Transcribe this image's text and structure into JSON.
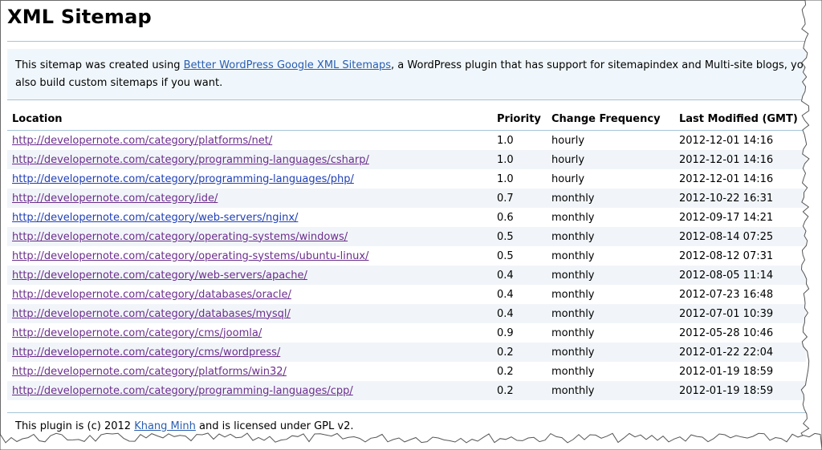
{
  "page": {
    "title": "XML Sitemap",
    "intro": {
      "text_before": "This sitemap was created using ",
      "plugin_link": "Better WordPress Google XML Sitemaps",
      "text_after": ", a WordPress plugin that has support for sitemapindex and Multi-site blogs, you can",
      "line2": "also build custom sitemaps if you want."
    },
    "table": {
      "headers": {
        "location": "Location",
        "priority": "Priority",
        "frequency": "Change Frequency",
        "modified": "Last Modified (GMT)"
      },
      "rows": [
        {
          "url": "http://developernote.com/category/platforms/net/",
          "priority": "1.0",
          "frequency": "hourly",
          "modified": "2012-12-01 14:16",
          "visited": true
        },
        {
          "url": "http://developernote.com/category/programming-languages/csharp/",
          "priority": "1.0",
          "frequency": "hourly",
          "modified": "2012-12-01 14:16",
          "visited": true
        },
        {
          "url": "http://developernote.com/category/programming-languages/php/",
          "priority": "1.0",
          "frequency": "hourly",
          "modified": "2012-12-01 14:16",
          "visited": false
        },
        {
          "url": "http://developernote.com/category/ide/",
          "priority": "0.7",
          "frequency": "monthly",
          "modified": "2012-10-22 16:31",
          "visited": true
        },
        {
          "url": "http://developernote.com/category/web-servers/nginx/",
          "priority": "0.6",
          "frequency": "monthly",
          "modified": "2012-09-17 14:21",
          "visited": false
        },
        {
          "url": "http://developernote.com/category/operating-systems/windows/",
          "priority": "0.5",
          "frequency": "monthly",
          "modified": "2012-08-14 07:25",
          "visited": true
        },
        {
          "url": "http://developernote.com/category/operating-systems/ubuntu-linux/",
          "priority": "0.5",
          "frequency": "monthly",
          "modified": "2012-08-12 07:31",
          "visited": true
        },
        {
          "url": "http://developernote.com/category/web-servers/apache/",
          "priority": "0.4",
          "frequency": "monthly",
          "modified": "2012-08-05 11:14",
          "visited": true
        },
        {
          "url": "http://developernote.com/category/databases/oracle/",
          "priority": "0.4",
          "frequency": "monthly",
          "modified": "2012-07-23 16:48",
          "visited": true
        },
        {
          "url": "http://developernote.com/category/databases/mysql/",
          "priority": "0.4",
          "frequency": "monthly",
          "modified": "2012-07-01 10:39",
          "visited": true
        },
        {
          "url": "http://developernote.com/category/cms/joomla/",
          "priority": "0.9",
          "frequency": "monthly",
          "modified": "2012-05-28 10:46",
          "visited": true
        },
        {
          "url": "http://developernote.com/category/cms/wordpress/",
          "priority": "0.2",
          "frequency": "monthly",
          "modified": "2012-01-22 22:04",
          "visited": true
        },
        {
          "url": "http://developernote.com/category/platforms/win32/",
          "priority": "0.2",
          "frequency": "monthly",
          "modified": "2012-01-19 18:59",
          "visited": true
        },
        {
          "url": "http://developernote.com/category/programming-languages/cpp/",
          "priority": "0.2",
          "frequency": "monthly",
          "modified": "2012-01-19 18:59",
          "visited": true
        }
      ]
    },
    "footer": {
      "text_before": "This plugin is (c) 2012 ",
      "author_link": "Khang Minh",
      "text_after": " and is licensed under GPL v2."
    }
  },
  "colors": {
    "visited_link": "#6b2d8c",
    "link": "#1f3fb8",
    "rule": "#a6c4d6",
    "intro_bg": "#f0f7fc"
  }
}
